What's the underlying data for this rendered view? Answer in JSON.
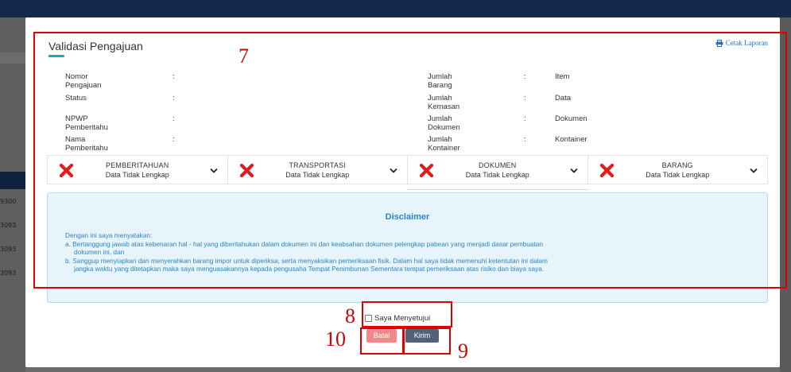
{
  "background": {
    "row_ids": [
      "9300",
      "3093",
      "3093",
      "3093"
    ]
  },
  "modal": {
    "title": "Validasi Pengajuan",
    "print_label": "Cetak Laporan",
    "info_left": [
      {
        "label": "Nomor Pengajuan",
        "colon": ":",
        "value": ""
      },
      {
        "label": "Status",
        "colon": ":",
        "value": ""
      },
      {
        "label": "NPWP Pemberitahu",
        "colon": ":",
        "value": ""
      },
      {
        "label": "Nama Pemberitahu",
        "colon": ":",
        "value": ""
      }
    ],
    "info_right": [
      {
        "label": "Jumlah Barang",
        "colon": ":",
        "value": "Item"
      },
      {
        "label": "Jumlah Kemasan",
        "colon": ":",
        "value": "Data"
      },
      {
        "label": "Jumlah Dokumen",
        "colon": ":",
        "value": "Dokumen"
      },
      {
        "label": "Jumlah Kontainer",
        "colon": ":",
        "value": "Kontainer"
      }
    ],
    "sections": [
      {
        "name": "PEMBERITAHUAN",
        "state": "Data Tidak Lengkap"
      },
      {
        "name": "TRANSPORTASI",
        "state": "Data Tidak Lengkap"
      },
      {
        "name": "DOKUMEN",
        "state": "Data Tidak Lengkap"
      },
      {
        "name": "BARANG",
        "state": "Data Tidak Lengkap"
      }
    ],
    "disclaimer": {
      "title": "Disclaimer",
      "intro": "Dengan ini saya menyatakan:",
      "item_a_line1": "a. Bertanggung jawab atas kebenaran hal - hal yang diberitahukan dalam dokumen ini dan keabsahan dokumen pelengkap pabean yang menjadi dasar pembuatan",
      "item_a_line2": "dokumen ini, dan",
      "item_b_line1": "b. Sanggup menyiapkan dan menyerahkan barang impor untuk diperiksa, serta menyaksikan pemeriksaan fisik. Dalam hal saya tidak memenuhi ketentutan ini dalam",
      "item_b_line2": "jangka waktu yang ditetapkan maka saya menguasakannya kepada pengusaha Tempat Penimbunan Sementara tempat pemeriksaan atas risiko dan biaya saya."
    },
    "agree_label": "Saya Menyetujui",
    "cancel_label": "Batal",
    "submit_label": "Kirim"
  },
  "annotations": {
    "n7": "7",
    "n8": "8",
    "n9": "9",
    "n10": "10",
    "color": "#e00000"
  },
  "colors": {
    "accent": "#19a7d1",
    "link": "#1c75c4",
    "error_x": "#e01b1b",
    "disclaimer_text": "#2a86c3",
    "cancel_button": "#f08a8a",
    "submit_button": "#54617a"
  }
}
